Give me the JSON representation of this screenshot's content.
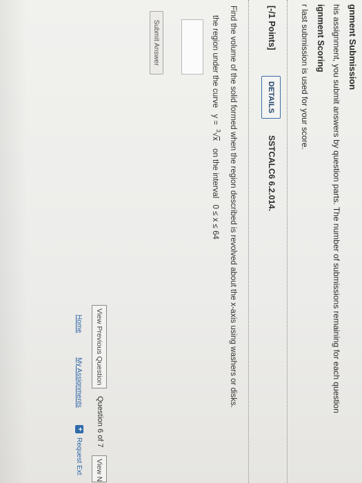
{
  "header": {
    "title": "gnment Submission",
    "intro": "his assignment, you submit answers by question parts. The number of submissions remaining for each question",
    "scoring_title": "ignment Scoring",
    "scoring_text": "r last submission is used for your score."
  },
  "question": {
    "points": "[-/1 Points]",
    "details_label": "DETAILS",
    "code": "SSTCALC6 6.2.014.",
    "prompt_line1": "Find the volume of the solid formed when the region described is revolved about the x-axis using washers or disks.",
    "prompt_line2_prefix": "the region under the curve",
    "curve_lhs": "y =",
    "root_index": "3",
    "radicand": "x",
    "prompt_line2_mid": "on the interval",
    "interval": "0 ≤ x ≤ 64",
    "answer_value": "",
    "submit_label": "Submit Answer"
  },
  "footer": {
    "prev_label": "View Previous Question",
    "question_count": "Question 6 of 7",
    "next_label": "View N",
    "home_label": "Home",
    "assignments_label": "My Assignments",
    "request_label": "Request Ext"
  }
}
